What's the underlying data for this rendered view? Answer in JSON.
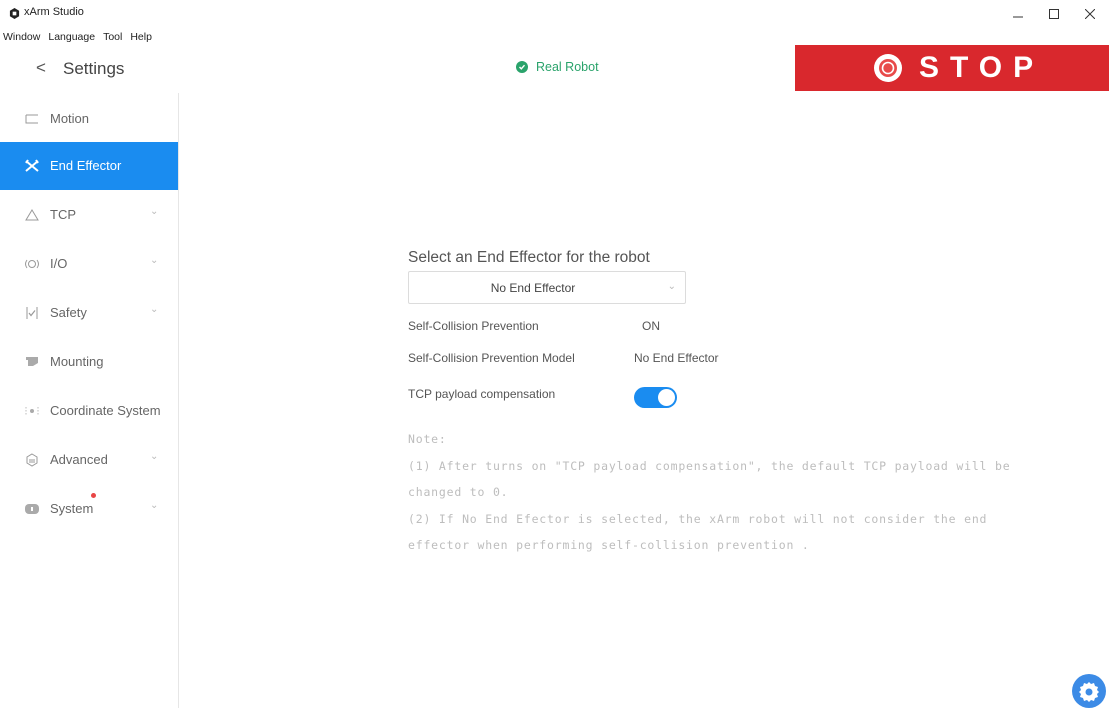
{
  "window": {
    "title": "xArm Studio"
  },
  "menu": [
    "Window",
    "Language",
    "Tool",
    "Help"
  ],
  "header": {
    "back_glyph": "<",
    "title": "Settings",
    "status": "Real Robot",
    "stop_label": "STOP"
  },
  "sidebar": {
    "items": [
      {
        "label": "Motion",
        "icon": "motion-icon"
      },
      {
        "label": "End Effector",
        "icon": "end-effector-icon",
        "active": true
      },
      {
        "label": "TCP",
        "icon": "tcp-icon"
      },
      {
        "label": "I/O",
        "icon": "io-icon"
      },
      {
        "label": "Safety",
        "icon": "safety-icon"
      },
      {
        "label": "Mounting",
        "icon": "mounting-icon"
      },
      {
        "label": "Coordinate System",
        "icon": "coordinate-icon"
      },
      {
        "label": "Advanced",
        "icon": "advanced-icon"
      },
      {
        "label": "System",
        "icon": "system-icon"
      }
    ]
  },
  "main": {
    "heading": "Select an End Effector for the robot",
    "selected_effector": "No End Effector",
    "rows": [
      {
        "label": "Self-Collision Prevention",
        "value": "ON"
      },
      {
        "label": "Self-Collision Prevention Model",
        "value": "No End Effector"
      },
      {
        "label": "TCP payload compensation",
        "toggle_on": true
      }
    ],
    "note_lines": [
      "Note:",
      "(1) After turns on \"TCP payload compensation\", the default TCP payload will be",
      "changed to 0.",
      "(2) If No End Efector is selected, the xArm robot will not consider the end",
      "effector when performing self-collision prevention ."
    ]
  },
  "colors": {
    "accent": "#1a8cf0",
    "stop": "#d9282d",
    "status": "#2aa36b"
  }
}
